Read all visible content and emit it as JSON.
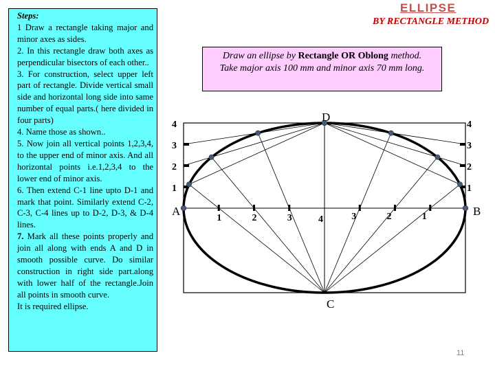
{
  "header": {
    "title": "ELLIPSE",
    "subtitle": "BY RECTANGLE METHOD"
  },
  "steps": {
    "heading": "Steps:",
    "items": [
      "1  Draw a rectangle taking major and minor axes as sides.",
      "2. In this rectangle draw both axes as perpendicular bisectors of each other..",
      "3. For construction, select upper left part of rectangle. Divide vertical small side and horizontal long side into same number of equal parts.( here divided in four parts)",
      "4. Name those as shown..",
      "5. Now join all vertical points 1,2,3,4, to the upper end of minor axis. And all horizontal points i.e.1,2,3,4 to the lower end of minor axis.",
      "6. Then extend C-1 line upto D-1 and mark that point. Similarly extend C-2, C-3, C-4 lines up to D-2, D-3, & D-4 lines.",
      "Mark all these points properly and join all along with ends A and D in smooth possible curve. Do similar construction in right side part.along with lower half of the rectangle.Join all points in smooth curve.",
      "It is required ellipse."
    ],
    "step7_number": "7."
  },
  "problem": {
    "line1_part1": "Draw an ellipse by ",
    "line1_bold": "Rectangle OR Oblong",
    "line1_part2": " method.",
    "line2": "Take major axis 100 mm and minor axis 70 mm long."
  },
  "diagram": {
    "major_axis_mm": 100,
    "minor_axis_mm": 70,
    "divisions": 4,
    "points": {
      "A": "A",
      "B": "B",
      "C": "C",
      "D": "D"
    },
    "left_vertical_labels": [
      "1",
      "2",
      "3",
      "4"
    ],
    "right_vertical_labels": [
      "1",
      "2",
      "3",
      "4"
    ],
    "left_horizontal_labels": [
      "1",
      "2",
      "3",
      "4"
    ],
    "right_horizontal_labels": [
      "1",
      "2",
      "3"
    ],
    "colors": {
      "ellipse": "#000000",
      "point_marker": "#4a5a7a",
      "construction_line": "#000000"
    }
  },
  "footer": {
    "page_number": "11"
  }
}
